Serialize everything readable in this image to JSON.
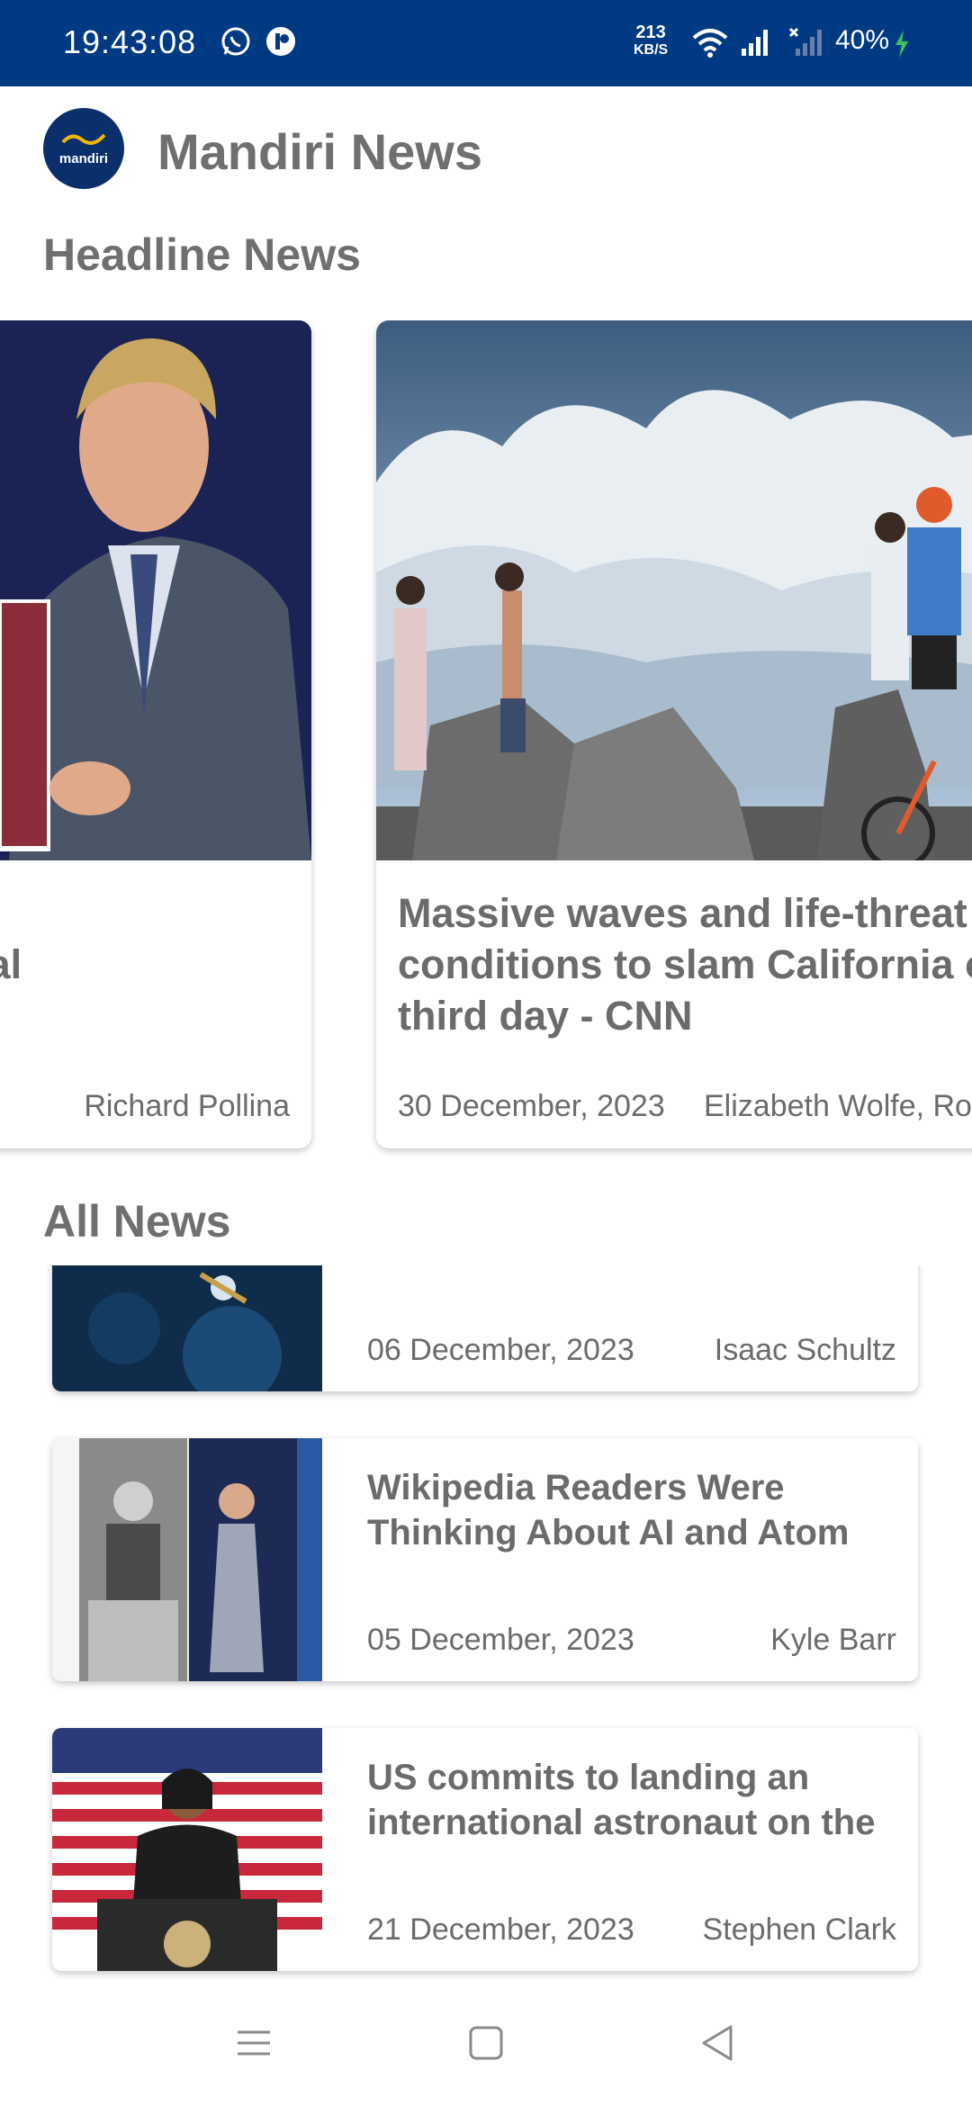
{
  "status_bar": {
    "time": "19:43:08",
    "speed_value": "213",
    "speed_unit": "KB/S",
    "battery": "40%",
    "icons": [
      "whatsapp-icon",
      "app-notification-icon",
      "wifi-icon",
      "signal-icon",
      "signal-x-icon",
      "battery-charging-icon"
    ]
  },
  "app": {
    "logo_text": "mandiri",
    "title": "Mandiri News"
  },
  "sections": {
    "headline": "Headline News",
    "all_news": "All News"
  },
  "headline_cards": [
    {
      "title": "n Idol'\n alleged sexual",
      "author": "Richard Pollina"
    },
    {
      "title": "Massive waves and life-threat\nconditions to slam California o\nthird day - CNN",
      "date": "30 December, 2023",
      "author": "Elizabeth Wolfe, Ro"
    }
  ],
  "news_list": [
    {
      "title": "",
      "date": "06 December, 2023",
      "author": "Isaac Schultz"
    },
    {
      "title": "Wikipedia Readers Were Thinking About AI and Atom",
      "date": "05 December, 2023",
      "author": "Kyle Barr"
    },
    {
      "title": "US commits to landing an international astronaut on the",
      "date": "21 December, 2023",
      "author": "Stephen Clark"
    }
  ],
  "colors": {
    "status_bar": "#003a82",
    "text_gray": "#6b6b6b"
  }
}
